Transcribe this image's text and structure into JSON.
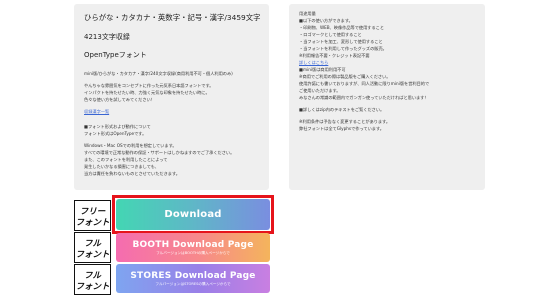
{
  "left": {
    "heading_1": "ひらがな・カタカナ・英数字・記号・漢字/3459文字",
    "heading_2": "4213文字収録",
    "heading_3": "OpenTypeフォント",
    "lines_1": [
      "mini版/ひらがな・カタカナ・漢字/240文字収録(商用利用不可・個人利用のみ)",
      " "
    ],
    "lines_2": [
      "やんちゃな雰囲気をコンセプトに作った元気系日本語フォントです。",
      "インパクトを持たせたい時、力強く元気な印象を持たせたい時に。",
      "色々な使い方を試してみてください！"
    ],
    "kanji_link": "収録漢字一覧",
    "lines_3": [
      "■フォント形式および動作について",
      "フォント形式はOpenTypeです。",
      " ",
      "Windows・Mac OSでの利用を想定しています。",
      "すべての環境で正常な動作の保証・サポートはしかねますのでご了承ください。",
      "また、このフォントを利用したことによって",
      "発生したいかなる損害につきましても、",
      "当方は責任を負わないものとさせていただきます。"
    ]
  },
  "right": {
    "lines_1": [
      "用途用量",
      "■以下の使い方ができます。",
      "・印刷物、WEB、映像作品等で使用すること",
      "・ロゴマークとして使用すること",
      "・当フォントを加工、変形して使用すること",
      "・当フォントを利用して作ったグッズの販売。",
      "※利用報告不要・クレジット表記不要"
    ],
    "terms_link": "詳しくはこちら",
    "lines_2": [
      "■mini版は商用利用不可",
      "※商用でご利用の際は製品版をご購入ください。",
      "使用許諾にも書いておりますが、同人活動に限りmini版を営利目的で",
      "ご使用いただけます。",
      "みなさんの常識の範囲内でガンガン使っていただければと思います！"
    ],
    "lines_3": [
      "■詳しくはzip内のテキストをご覧ください。"
    ],
    "lines_4": [
      "※利用条件は予告なく変更することがあります。",
      "弊社フォントは全てGlyphsで作っています。"
    ]
  },
  "buttons": {
    "download_label": "Download",
    "booth_label": "BOOTH Download Page",
    "booth_sub": "フルバージョンはBOOTHの購入ページからで",
    "stores_label": "STORES Download Page",
    "stores_sub": "フルバージョンはSTORESの購入ページからで"
  },
  "logos": {
    "free_line1": "フリー",
    "free_line2": "フォント",
    "full_line1": "フル",
    "full_line2": "フォント"
  },
  "colors": {
    "highlight": "#e6141b",
    "link": "#3a66d3"
  }
}
